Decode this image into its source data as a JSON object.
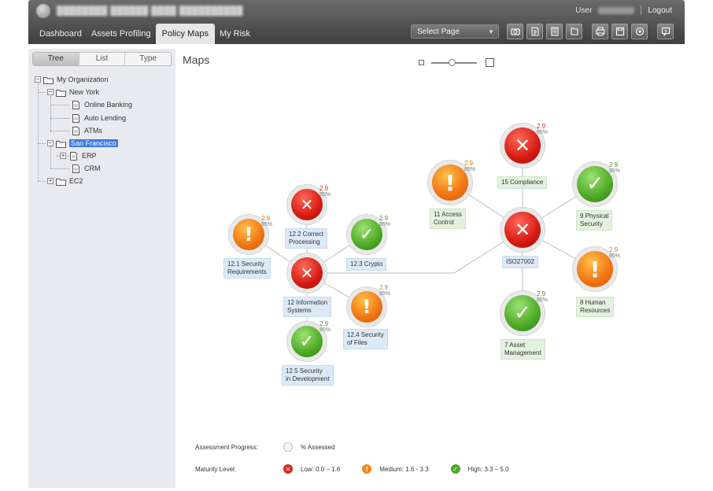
{
  "header": {
    "user_label": "User",
    "logout_label": "Logout",
    "nav_tabs": [
      {
        "label": "Dashboard",
        "active": false
      },
      {
        "label": "Assets Profiling",
        "active": false
      },
      {
        "label": "Policy Maps",
        "active": true
      },
      {
        "label": "My Risk",
        "active": false
      }
    ],
    "page_select_value": "Select Page",
    "toolbar_icons": [
      "camera-icon",
      "export-icon",
      "calculator-icon",
      "document-icon",
      "print-icon",
      "save-icon",
      "preview-icon",
      "chat-icon"
    ]
  },
  "sidebar": {
    "view_tabs": [
      {
        "label": "Tree",
        "active": true
      },
      {
        "label": "List",
        "active": false
      },
      {
        "label": "Type",
        "active": false
      }
    ],
    "tree": [
      {
        "label": "My Organization",
        "type": "folder",
        "toggle": "−",
        "selected": false
      },
      {
        "label": "New York",
        "type": "folder",
        "toggle": "−",
        "selected": false
      },
      {
        "label": "Online Banking",
        "type": "document",
        "toggle": "",
        "selected": false
      },
      {
        "label": "Auto Lending",
        "type": "document",
        "toggle": "",
        "selected": false
      },
      {
        "label": "ATMs",
        "type": "document",
        "toggle": "",
        "selected": false
      },
      {
        "label": "San Francisco",
        "type": "folder",
        "toggle": "−",
        "selected": true
      },
      {
        "label": "ERP",
        "type": "document",
        "toggle": "+",
        "selected": false
      },
      {
        "label": "CRM",
        "type": "document",
        "toggle": "",
        "selected": false
      },
      {
        "label": "EC2",
        "type": "folder",
        "toggle": "+",
        "selected": false
      }
    ]
  },
  "main": {
    "title": "Maps",
    "nodes": [
      {
        "id": "n121",
        "level": "medium",
        "label_lines": [
          "12.1 Security",
          "Requirements"
        ],
        "score": "2.9",
        "progress": "85%"
      },
      {
        "id": "n122",
        "level": "low",
        "label_lines": [
          "12.2 Correct",
          "Processing"
        ],
        "score": "2.9",
        "progress": "85%"
      },
      {
        "id": "n123",
        "level": "high",
        "label_lines": [
          "12.3 Crypto"
        ],
        "score": "2.9",
        "progress": "85%"
      },
      {
        "id": "n12",
        "level": "low",
        "label_lines": [
          "12 Information",
          "Systems"
        ],
        "score": "",
        "progress": ""
      },
      {
        "id": "n124",
        "level": "medium",
        "label_lines": [
          "12.4 Security",
          "of Files"
        ],
        "score": "2.9",
        "progress": "85%"
      },
      {
        "id": "n125",
        "level": "high",
        "label_lines": [
          "12.5 Security",
          "in Development"
        ],
        "score": "2.9",
        "progress": "85%"
      },
      {
        "id": "n11",
        "level": "medium",
        "label_lines": [
          "11 Access",
          "Control"
        ],
        "score": "2.9",
        "progress": "85%"
      },
      {
        "id": "n15",
        "level": "low",
        "label_lines": [
          "15 Compliance"
        ],
        "score": "2.9",
        "progress": "85%"
      },
      {
        "id": "n9",
        "level": "high",
        "label_lines": [
          "9 Physical",
          "Security"
        ],
        "score": "2.9",
        "progress": "85%"
      },
      {
        "id": "iso",
        "level": "low",
        "label_lines": [
          "ISO27002"
        ],
        "score": "",
        "progress": ""
      },
      {
        "id": "n8",
        "level": "medium",
        "label_lines": [
          "8 Human",
          "Resources"
        ],
        "score": "2.9",
        "progress": "85%"
      },
      {
        "id": "n7",
        "level": "high",
        "label_lines": [
          "7 Asset",
          "Management"
        ],
        "score": "2.9",
        "progress": "85%"
      }
    ],
    "legend": {
      "progress_title": "Assessment Progress:",
      "progress_label": "% Assessed",
      "maturity_title": "Maturity Level:",
      "levels": [
        {
          "level": "low",
          "label": "Low: 0.0 – 1.6"
        },
        {
          "level": "medium",
          "label": "Medium: 1.6 - 3.3"
        },
        {
          "level": "high",
          "label": "High: 3.3 – 5.0"
        }
      ]
    }
  }
}
